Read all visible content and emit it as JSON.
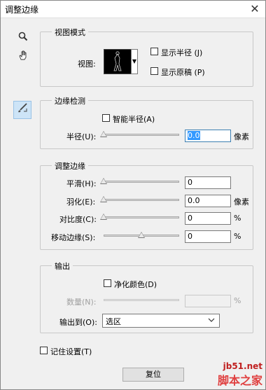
{
  "window": {
    "title": "调整边缘",
    "close_glyph": "✕"
  },
  "tools": {
    "zoom": "zoom-icon",
    "hand": "hand-icon",
    "brush": "refine-radius-brush-icon"
  },
  "view_mode": {
    "legend": "视图模式",
    "view_label": "视图:",
    "show_radius": "显示半径 (J)",
    "show_original": "显示原稿 (P)"
  },
  "edge_detection": {
    "legend": "边缘检测",
    "smart_radius": "智能半径(A)",
    "radius_label": "半径(U):",
    "radius_value": "0.0",
    "radius_unit": "像素",
    "radius_level": 0
  },
  "adjust_edge": {
    "legend": "调整边缘",
    "smooth_label": "平滑(H):",
    "smooth_value": "0",
    "smooth_level": 0,
    "feather_label": "羽化(E):",
    "feather_value": "0.0",
    "feather_unit": "像素",
    "feather_level": 0,
    "contrast_label": "对比度(C):",
    "contrast_value": "0",
    "contrast_unit": "%",
    "contrast_level": 0,
    "shift_label": "移动边缘(S):",
    "shift_value": "0",
    "shift_unit": "%",
    "shift_level": 0.5
  },
  "output": {
    "legend": "输出",
    "decontaminate": "净化颜色(D)",
    "amount_label": "数量(N):",
    "amount_value": "",
    "amount_unit": "%",
    "output_to_label": "输出到(O):",
    "output_to_value": "选区"
  },
  "remember": "记住设置(T)",
  "reset_button": "复位",
  "watermark": {
    "line1": "jb51.net",
    "line2": "脚本之家"
  }
}
